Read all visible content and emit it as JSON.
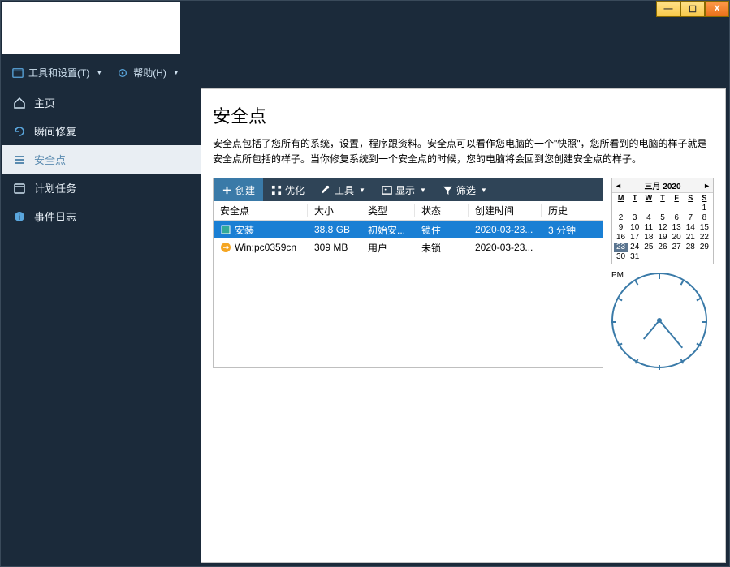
{
  "window": {
    "min": "—",
    "max": "☐",
    "close": "X"
  },
  "menubar": {
    "tools": "工具和设置(T)",
    "help": "帮助(H)"
  },
  "sidebar": {
    "items": [
      {
        "label": "主页"
      },
      {
        "label": "瞬间修复"
      },
      {
        "label": "安全点"
      },
      {
        "label": "计划任务"
      },
      {
        "label": "事件日志"
      }
    ]
  },
  "main": {
    "title": "安全点",
    "desc": "安全点包括了您所有的系统，设置，程序跟资料。安全点可以看作您电脑的一个\"快照\"，您所看到的电脑的样子就是安全点所包括的样子。当你修复系统到一个安全点的时候，您的电脑将会回到您创建安全点的样子。"
  },
  "toolbar": {
    "create": "创建",
    "optimize": "优化",
    "tools": "工具",
    "display": "显示",
    "filter": "筛选"
  },
  "table": {
    "headers": {
      "snapshot": "安全点",
      "size": "大小",
      "type": "类型",
      "state": "状态",
      "created": "创建时间",
      "history": "历史"
    },
    "rows": [
      {
        "name": "安装",
        "size": "38.8 GB",
        "type": "初始安...",
        "state": "锁住",
        "created": "2020-03-23...",
        "history": "3 分钟",
        "selected": true,
        "icon": "install"
      },
      {
        "name": "Win:pc0359cn",
        "size": "309 MB",
        "type": "用户",
        "state": "未锁",
        "created": "2020-03-23...",
        "history": "",
        "selected": false,
        "icon": "arrow"
      }
    ]
  },
  "calendar": {
    "title": "三月 2020",
    "dow": [
      "M",
      "T",
      "W",
      "T",
      "F",
      "S",
      "S"
    ],
    "cells": [
      {
        "n": "",
        "dim": true
      },
      {
        "n": "",
        "dim": true
      },
      {
        "n": "",
        "dim": true
      },
      {
        "n": "",
        "dim": true
      },
      {
        "n": "",
        "dim": true
      },
      {
        "n": "",
        "dim": true
      },
      {
        "n": "1"
      },
      {
        "n": "2"
      },
      {
        "n": "3"
      },
      {
        "n": "4"
      },
      {
        "n": "5"
      },
      {
        "n": "6"
      },
      {
        "n": "7"
      },
      {
        "n": "8"
      },
      {
        "n": "9"
      },
      {
        "n": "10"
      },
      {
        "n": "11"
      },
      {
        "n": "12"
      },
      {
        "n": "13"
      },
      {
        "n": "14"
      },
      {
        "n": "15"
      },
      {
        "n": "16"
      },
      {
        "n": "17"
      },
      {
        "n": "18"
      },
      {
        "n": "19"
      },
      {
        "n": "20"
      },
      {
        "n": "21"
      },
      {
        "n": "22"
      },
      {
        "n": "23",
        "today": true
      },
      {
        "n": "24"
      },
      {
        "n": "25"
      },
      {
        "n": "26"
      },
      {
        "n": "27"
      },
      {
        "n": "28"
      },
      {
        "n": "29"
      },
      {
        "n": "30"
      },
      {
        "n": "31"
      },
      {
        "n": "",
        "dim": true
      },
      {
        "n": "",
        "dim": true
      },
      {
        "n": "",
        "dim": true
      },
      {
        "n": "",
        "dim": true
      },
      {
        "n": "",
        "dim": true
      }
    ]
  },
  "clock": {
    "ampm": "PM",
    "hour_angle": 220,
    "minute_angle": 140
  }
}
